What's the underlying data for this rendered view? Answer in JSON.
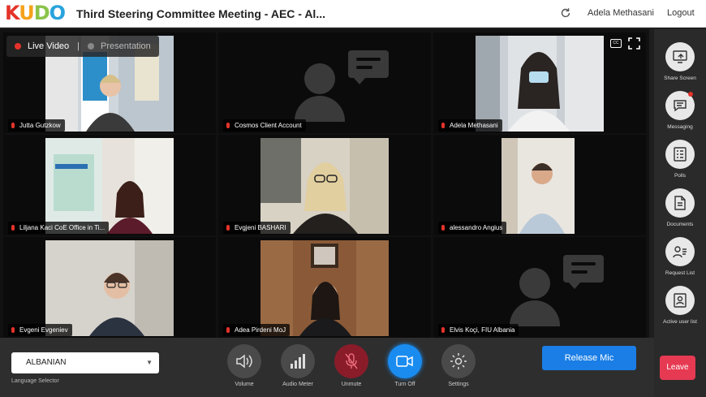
{
  "app": {
    "logo": [
      "K",
      "U",
      "D",
      "O"
    ],
    "title": "Third Steering Committee Meeting - AEC - Al...",
    "username": "Adela Methasani",
    "logout_label": "Logout"
  },
  "stage": {
    "live_label": "Live Video",
    "separator": "|",
    "presentation_label": "Presentation",
    "cc_label": "CC"
  },
  "participants": [
    {
      "name": "Jutta Gutzkow",
      "video": true
    },
    {
      "name": "Cosmos Client Account",
      "video": false
    },
    {
      "name": "Adela Methasani",
      "video": true
    },
    {
      "name": "Liljana Kaci CoE Office in Ti...",
      "video": true
    },
    {
      "name": "Evgjeni BASHARI",
      "video": true
    },
    {
      "name": "alessandro Angius",
      "video": true
    },
    {
      "name": "Evgeni Evgeniev",
      "video": true
    },
    {
      "name": "Adea Pirdeni MoJ",
      "video": true
    },
    {
      "name": "Elvis Koçi, FIU Albania",
      "video": false
    }
  ],
  "sidebar": {
    "items": [
      {
        "label": "Share Screen",
        "icon": "share-screen-icon"
      },
      {
        "label": "Messaging",
        "icon": "messaging-icon",
        "badge": true
      },
      {
        "label": "Polls",
        "icon": "polls-icon"
      },
      {
        "label": "Documents",
        "icon": "documents-icon"
      },
      {
        "label": "Request List",
        "icon": "request-list-icon"
      },
      {
        "label": "Active user list",
        "icon": "active-user-list-icon"
      }
    ],
    "leave_label": "Leave"
  },
  "bottom": {
    "language_value": "ALBANIAN",
    "language_label": "Language Selector",
    "controls": [
      {
        "label": "Volume",
        "icon": "volume-icon"
      },
      {
        "label": "Audio Meter",
        "icon": "audio-meter-icon"
      },
      {
        "label": "Unmute",
        "icon": "mic-muted-icon"
      },
      {
        "label": "Turn Off",
        "icon": "camera-icon"
      },
      {
        "label": "Settings",
        "icon": "gear-icon"
      }
    ],
    "release_label": "Release Mic"
  },
  "colors": {
    "accent_blue": "#1a7ee6",
    "danger_red": "#e4332a",
    "leave_red": "#e63a52",
    "unmute_bg": "#8a1c2a",
    "camera_bg": "#1a8cf0"
  }
}
